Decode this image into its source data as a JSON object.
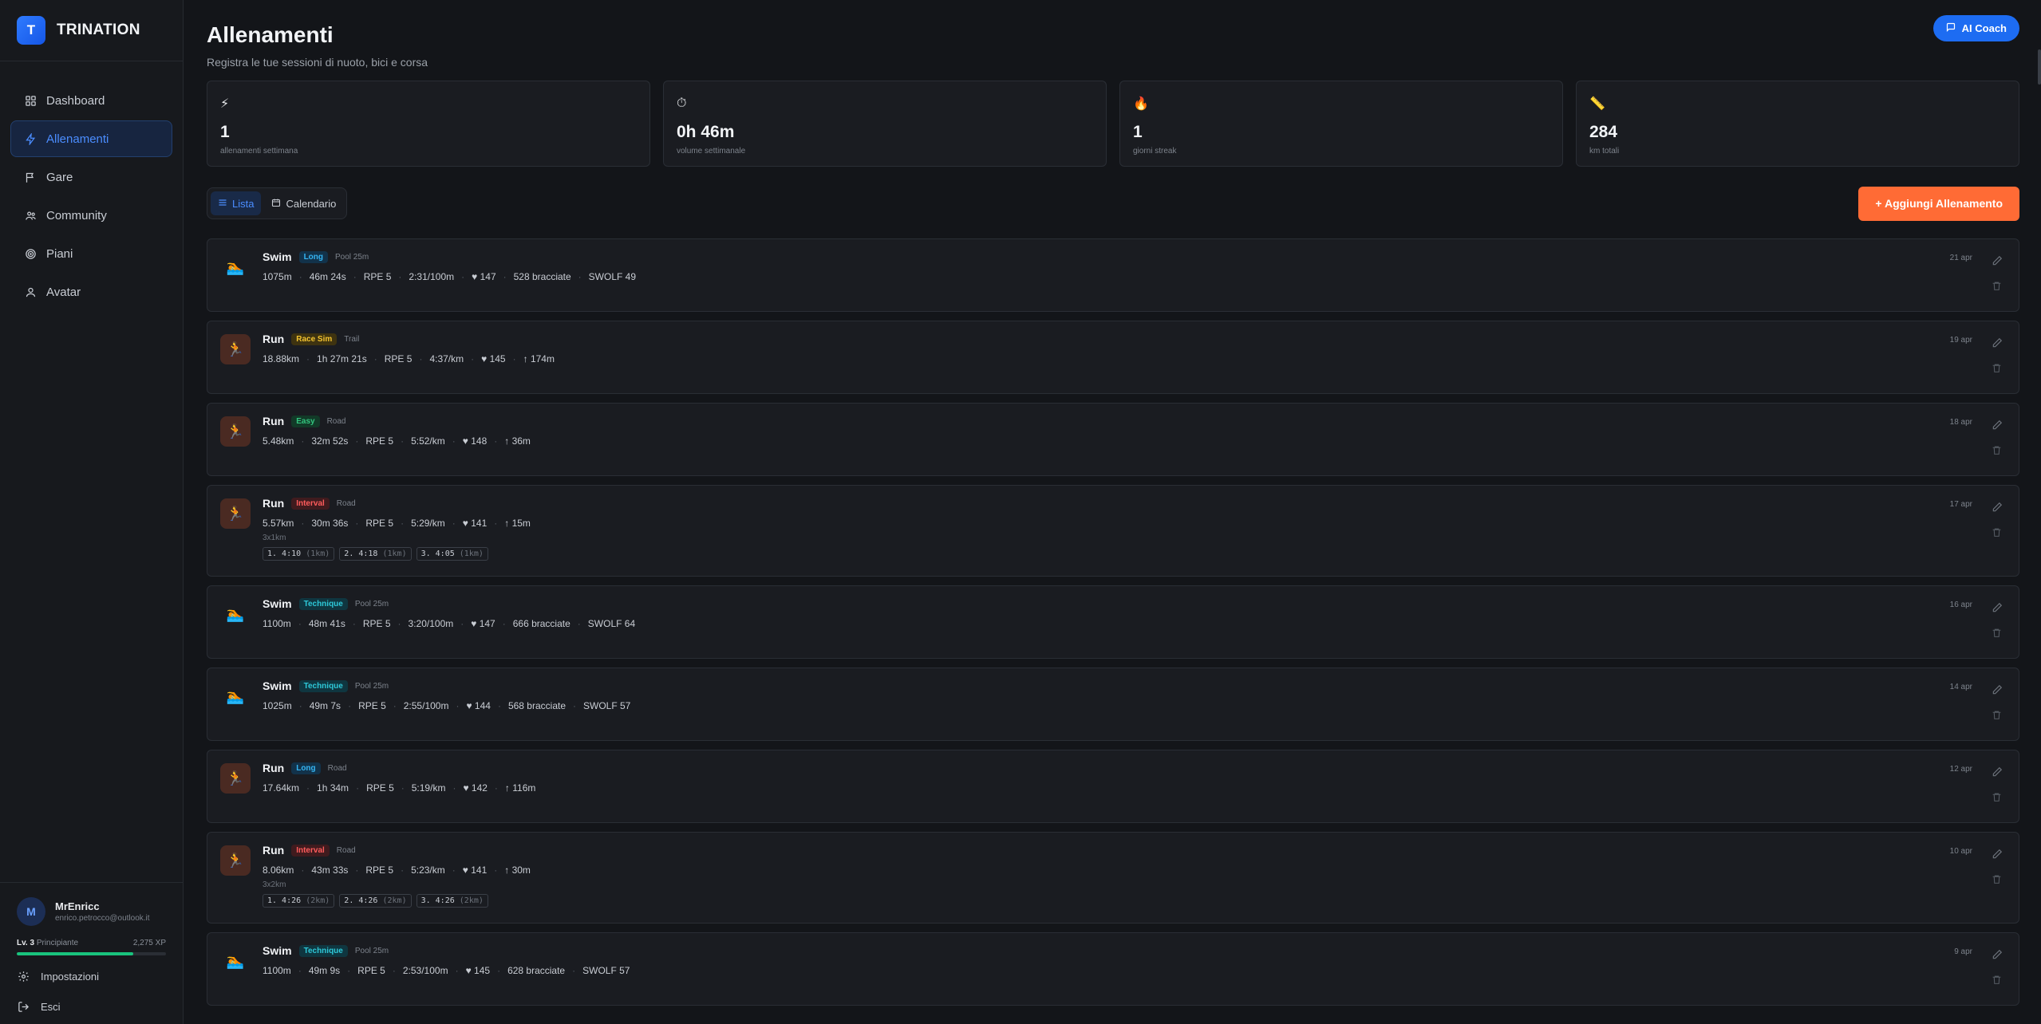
{
  "brand": {
    "logo_letter": "T",
    "name": "TRINATION"
  },
  "nav": [
    {
      "label": "Dashboard",
      "icon": "grid-icon"
    },
    {
      "label": "Allenamenti",
      "icon": "bolt-icon",
      "active": true
    },
    {
      "label": "Gare",
      "icon": "flag-icon"
    },
    {
      "label": "Community",
      "icon": "users-icon"
    },
    {
      "label": "Piani",
      "icon": "target-icon"
    },
    {
      "label": "Avatar",
      "icon": "user-icon"
    }
  ],
  "user": {
    "initial": "M",
    "name": "MrEnricc",
    "email": "enrico.petrocco@outlook.it",
    "level": "Lv. 3",
    "rank": "Principiante",
    "xp": "2,275 XP",
    "xp_progress": 0.78
  },
  "sidebar_links": {
    "settings": "Impostazioni",
    "logout": "Esci"
  },
  "header": {
    "title": "Allenamenti",
    "subtitle": "Registra le tue sessioni di nuoto, bici e corsa",
    "ai_button": "AI Coach"
  },
  "stats": [
    {
      "icon": "⚡",
      "value": "1",
      "label": "allenamenti settimana"
    },
    {
      "icon": "⏱",
      "value": "0h 46m",
      "label": "volume settimanale"
    },
    {
      "icon": "🔥",
      "value": "1",
      "label": "giorni streak"
    },
    {
      "icon": "📏",
      "value": "284",
      "label": "km totali"
    }
  ],
  "view_toggle": {
    "list": "Lista",
    "calendar": "Calendario"
  },
  "add_button": "+ Aggiungi Allenamento",
  "workouts": [
    {
      "type": "swim",
      "name": "Swim",
      "tag": "Long",
      "tag_class": "long",
      "sub": "Pool 25m",
      "date": "21 apr",
      "metrics": [
        "1075m",
        "46m 24s",
        "RPE 5",
        "2:31/100m",
        "♥ 147",
        "528 bracciate",
        "SWOLF 49"
      ]
    },
    {
      "type": "run",
      "name": "Run",
      "tag": "Race Sim",
      "tag_class": "race",
      "sub": "Trail",
      "date": "19 apr",
      "metrics": [
        "18.88km",
        "1h 27m 21s",
        "RPE 5",
        "4:37/km",
        "♥ 145",
        "↑ 174m"
      ]
    },
    {
      "type": "run",
      "name": "Run",
      "tag": "Easy",
      "tag_class": "easy",
      "sub": "Road",
      "date": "18 apr",
      "metrics": [
        "5.48km",
        "32m 52s",
        "RPE 5",
        "5:52/km",
        "♥ 148",
        "↑ 36m"
      ]
    },
    {
      "type": "run",
      "name": "Run",
      "tag": "Interval",
      "tag_class": "interval",
      "sub": "Road",
      "date": "17 apr",
      "metrics": [
        "5.57km",
        "30m 36s",
        "RPE 5",
        "5:29/km",
        "♥ 141",
        "↑ 15m"
      ],
      "reps": "3x1km",
      "splits": [
        {
          "main": "1. 4:10",
          "dim": "(1km)"
        },
        {
          "main": "2. 4:18",
          "dim": "(1km)"
        },
        {
          "main": "3. 4:05",
          "dim": "(1km)"
        }
      ]
    },
    {
      "type": "swim",
      "name": "Swim",
      "tag": "Technique",
      "tag_class": "technique",
      "sub": "Pool 25m",
      "date": "16 apr",
      "metrics": [
        "1100m",
        "48m 41s",
        "RPE 5",
        "3:20/100m",
        "♥ 147",
        "666 bracciate",
        "SWOLF 64"
      ]
    },
    {
      "type": "swim",
      "name": "Swim",
      "tag": "Technique",
      "tag_class": "technique",
      "sub": "Pool 25m",
      "date": "14 apr",
      "metrics": [
        "1025m",
        "49m 7s",
        "RPE 5",
        "2:55/100m",
        "♥ 144",
        "568 bracciate",
        "SWOLF 57"
      ]
    },
    {
      "type": "run",
      "name": "Run",
      "tag": "Long",
      "tag_class": "long",
      "sub": "Road",
      "date": "12 apr",
      "metrics": [
        "17.64km",
        "1h 34m",
        "RPE 5",
        "5:19/km",
        "♥ 142",
        "↑ 116m"
      ]
    },
    {
      "type": "run",
      "name": "Run",
      "tag": "Interval",
      "tag_class": "interval",
      "sub": "Road",
      "date": "10 apr",
      "metrics": [
        "8.06km",
        "43m 33s",
        "RPE 5",
        "5:23/km",
        "♥ 141",
        "↑ 30m"
      ],
      "reps": "3x2km",
      "splits": [
        {
          "main": "1. 4:26",
          "dim": "(2km)"
        },
        {
          "main": "2. 4:26",
          "dim": "(2km)"
        },
        {
          "main": "3. 4:26",
          "dim": "(2km)"
        }
      ]
    },
    {
      "type": "swim",
      "name": "Swim",
      "tag": "Technique",
      "tag_class": "technique",
      "sub": "Pool 25m",
      "date": "9 apr",
      "metrics": [
        "1100m",
        "49m 9s",
        "RPE 5",
        "2:53/100m",
        "♥ 145",
        "628 bracciate",
        "SWOLF 57"
      ]
    }
  ],
  "colors": {
    "accent": "#1d6cf2",
    "add_button": "#ff6b35",
    "xp": "#19c37d"
  }
}
